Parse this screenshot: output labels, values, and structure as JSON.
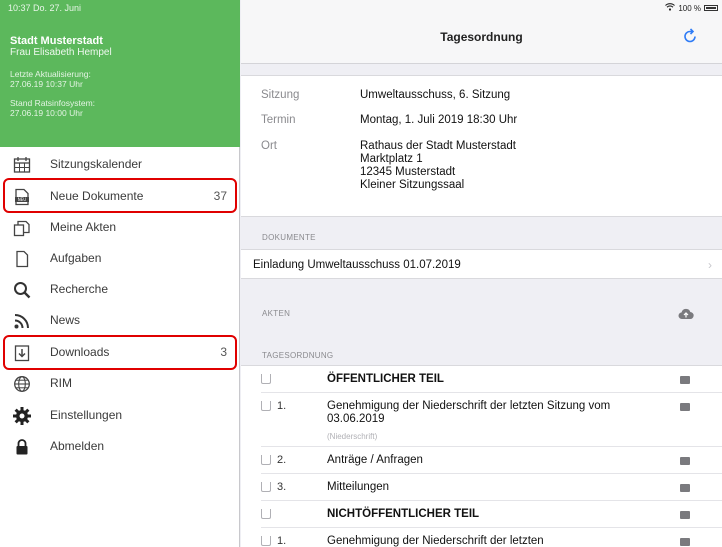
{
  "status": {
    "time_date": "10:37  Do. 27. Juni",
    "battery": "100 %"
  },
  "header": {
    "city": "Stadt Musterstadt",
    "user": "Frau Elisabeth Hempel",
    "last_update_label": "Letzte Aktualisierung:",
    "last_update_value": "27.06.19 10:37 Uhr",
    "rs_label": "Stand Ratsinfosystem:",
    "rs_value": "27.06.19 10:00 Uhr"
  },
  "nav": [
    {
      "label": "Sitzungskalender",
      "icon": "calendar-icon",
      "count": ""
    },
    {
      "label": "Neue Dokumente",
      "icon": "new-document-icon",
      "count": "37"
    },
    {
      "label": "Meine Akten",
      "icon": "folders-icon",
      "count": ""
    },
    {
      "label": "Aufgaben",
      "icon": "document-icon",
      "count": ""
    },
    {
      "label": "Recherche",
      "icon": "search-icon",
      "count": ""
    },
    {
      "label": "News",
      "icon": "rss-icon",
      "count": ""
    },
    {
      "label": "Downloads",
      "icon": "download-icon",
      "count": "3"
    },
    {
      "label": "RIM",
      "icon": "globe-icon",
      "count": ""
    },
    {
      "label": "Einstellungen",
      "icon": "gear-icon",
      "count": ""
    },
    {
      "label": "Abmelden",
      "icon": "lock-icon",
      "count": ""
    }
  ],
  "main": {
    "title": "Tagesordnung",
    "meeting": {
      "sitzung_label": "Sitzung",
      "sitzung_value": "Umweltausschuss, 6. Sitzung",
      "termin_label": "Termin",
      "termin_value": "Montag, 1. Juli 2019 18:30 Uhr",
      "ort_label": "Ort",
      "ort_lines": [
        "Rathaus der Stadt Musterstadt",
        "Marktplatz 1",
        "12345 Musterstadt",
        "Kleiner Sitzungssaal"
      ]
    },
    "documents_header": "DOKUMENTE",
    "document": "Einladung Umweltausschuss 01.07.2019",
    "akten_header": "AKTEN",
    "agenda_header": "TAGESORDNUNG",
    "agenda": [
      {
        "num": "",
        "title": "ÖFFENTLICHER TEIL",
        "bold": true,
        "sub": ""
      },
      {
        "num": "1.",
        "title": "Genehmigung der Niederschrift der letzten Sitzung vom 03.06.2019",
        "bold": false,
        "sub": "(Niederschrift)"
      },
      {
        "num": "2.",
        "title": "Anträge / Anfragen",
        "bold": false,
        "sub": ""
      },
      {
        "num": "3.",
        "title": "Mitteilungen",
        "bold": false,
        "sub": ""
      },
      {
        "num": "",
        "title": "NICHTÖFFENTLICHER TEIL",
        "bold": true,
        "sub": ""
      },
      {
        "num": "1.",
        "title": "Genehmigung der Niederschrift der letzten",
        "bold": false,
        "sub": ""
      }
    ]
  },
  "colors": {
    "header_green": "#5cb85c",
    "highlight_red": "#e00000",
    "accent_blue": "#2f7cf6"
  }
}
